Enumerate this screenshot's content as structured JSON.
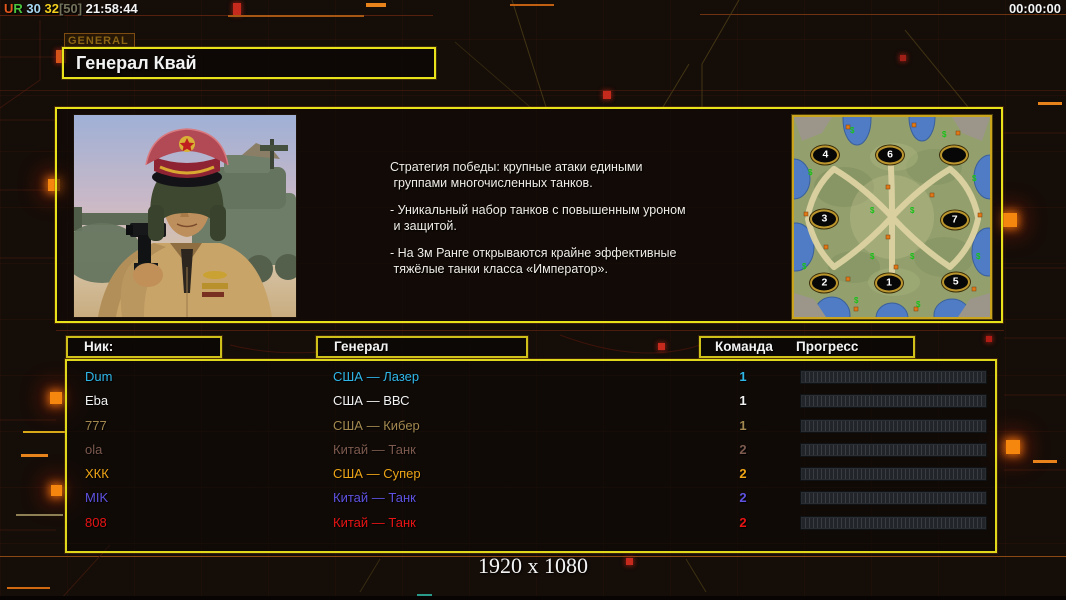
{
  "topbar": {
    "status_segments": [
      {
        "text": "U",
        "color": "#e8571c"
      },
      {
        "text": "R",
        "color": "#49c63e"
      },
      {
        "text": " 30 ",
        "color": "#a6d8f2"
      },
      {
        "text": "32",
        "color": "#f2cf1e"
      },
      {
        "text": "[50]",
        "color": "#73735c"
      },
      {
        "text": " 21:58:44",
        "color": "#f4f4f4"
      }
    ],
    "timer": "00:00:00"
  },
  "header": {
    "tab_label": "GENERAL",
    "title": "Генерал Квай"
  },
  "description": {
    "lines": [
      "Стратегия победы: крупные атаки едиными",
      " группами многочисленных танков.",
      "",
      "- Уникальный набор танков с повышенным уроном",
      " и защитой.",
      "",
      "- На 3м Ранге открываются крайне эффективные",
      " тяжёлые танки класса «Император»."
    ]
  },
  "minimap": {
    "markers": [
      {
        "label": "4",
        "x": 16,
        "y": 19
      },
      {
        "label": "6",
        "x": 49,
        "y": 19
      },
      {
        "label": "",
        "x": 81.5,
        "y": 19
      },
      {
        "label": "3",
        "x": 15.5,
        "y": 51
      },
      {
        "label": "7",
        "x": 82,
        "y": 51.5
      },
      {
        "label": "2",
        "x": 15.5,
        "y": 83
      },
      {
        "label": "1",
        "x": 48.5,
        "y": 83
      },
      {
        "label": "5",
        "x": 82.5,
        "y": 82.5
      }
    ]
  },
  "table": {
    "headers": {
      "nick": "Ник:",
      "general": "Генерал",
      "team": "Команда",
      "progress": "Прогресс"
    },
    "rows": [
      {
        "nick": "Dum",
        "general": "США — Лазер",
        "team": "1",
        "color": "#2fb7e8",
        "progress_percent": 0
      },
      {
        "nick": "Eba",
        "general": "США — ВВС",
        "team": "1",
        "color": "#f2f2f2",
        "progress_percent": 0
      },
      {
        "nick": "777",
        "general": "США — Кибер",
        "team": "1",
        "color": "#a3894f",
        "progress_percent": 0
      },
      {
        "nick": "ola",
        "general": "Китай — Танк",
        "team": "2",
        "color": "#7d5a4e",
        "progress_percent": 0
      },
      {
        "nick": "ХКК",
        "general": "США — Супер",
        "team": "2",
        "color": "#eda416",
        "progress_percent": 0
      },
      {
        "nick": "MIK",
        "general": "Китай — Танк",
        "team": "2",
        "color": "#5e52e0",
        "progress_percent": 0
      },
      {
        "nick": "808",
        "general": "Китай — Танк",
        "team": "2",
        "color": "#e81414",
        "progress_percent": 0
      }
    ]
  },
  "footer": {
    "resolution": "1920 x 1080"
  }
}
